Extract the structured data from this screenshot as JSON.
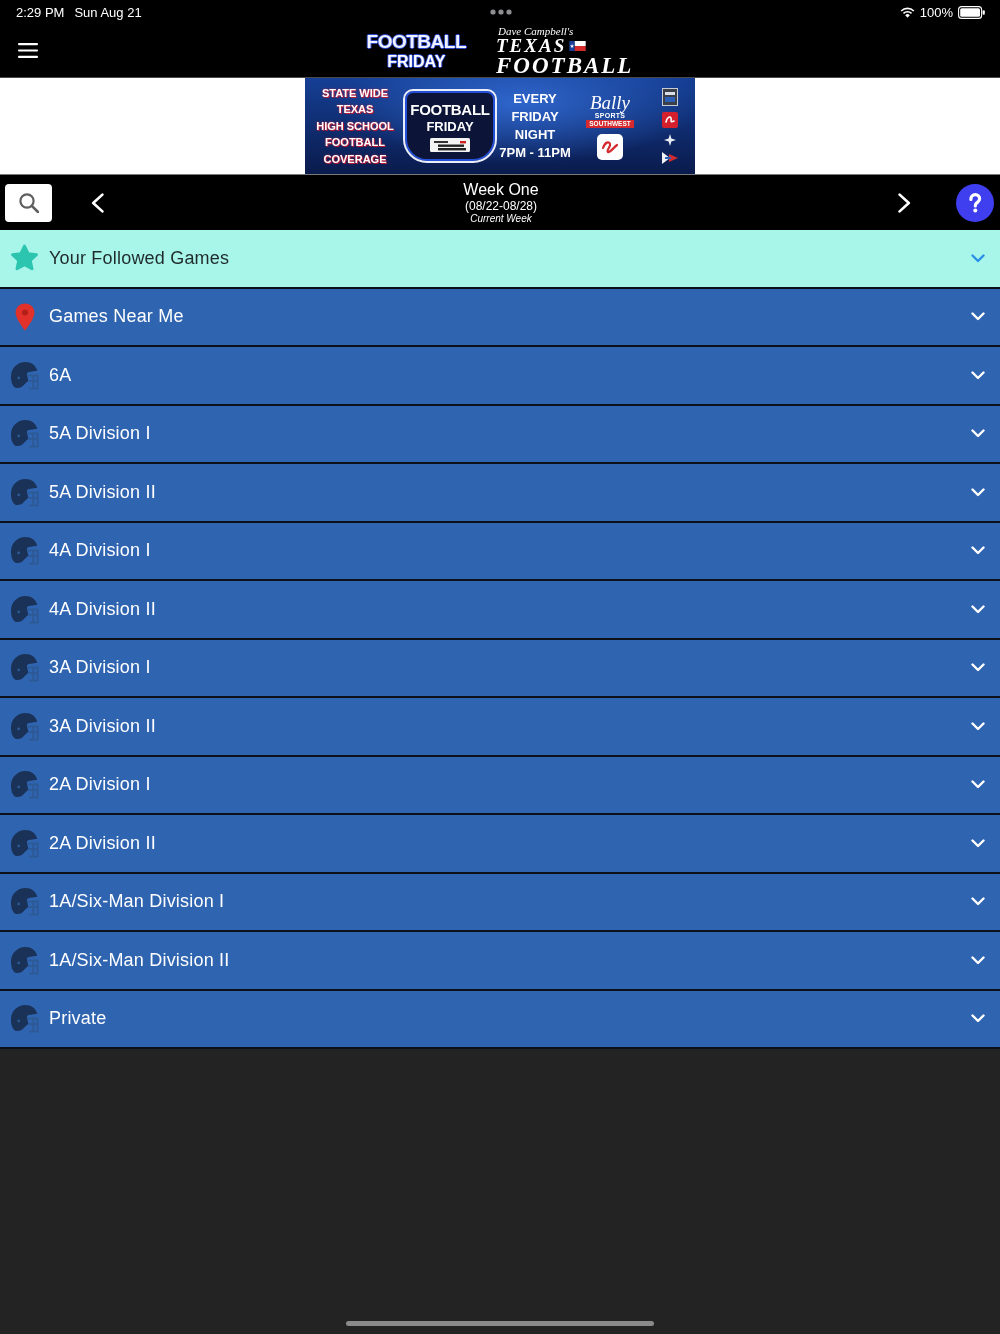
{
  "status_bar": {
    "time": "2:29 PM",
    "date": "Sun Aug 21",
    "battery": "100%"
  },
  "header": {
    "logo_left": {
      "line_1": "FOOTBALL",
      "line_2": "FRIDAY"
    },
    "logo_right": {
      "script": "Dave Campbell's",
      "line_1": "TEXAS",
      "line_2": "FOOTBALL"
    }
  },
  "banner": {
    "coverage_lines": [
      "STATE WIDE",
      "TEXAS",
      "HIGH SCHOOL",
      "FOOTBALL",
      "COVERAGE"
    ],
    "logo": {
      "line_1": "FOOTBALL",
      "line_2": "FRIDAY"
    },
    "schedule_lines": [
      "EVERY",
      "FRIDAY",
      "NIGHT",
      "7PM - 11PM"
    ],
    "network": {
      "script": "Bally",
      "line_1": "SPORTS",
      "line_2": "SOUTHWEST"
    }
  },
  "week_nav": {
    "title": "Week One",
    "dates": "(08/22-08/28)",
    "subtitle": "Current Week"
  },
  "sections": [
    {
      "kind": "followed",
      "label": "Your Followed Games",
      "expanded": false
    },
    {
      "kind": "nearby",
      "label": "Games Near Me",
      "expanded": false
    },
    {
      "kind": "division",
      "label": "6A",
      "expanded": false
    },
    {
      "kind": "division",
      "label": "5A Division I",
      "expanded": false
    },
    {
      "kind": "division",
      "label": "5A Division II",
      "expanded": false
    },
    {
      "kind": "division",
      "label": "4A Division I",
      "expanded": false
    },
    {
      "kind": "division",
      "label": "4A Division II",
      "expanded": false
    },
    {
      "kind": "division",
      "label": "3A Division I",
      "expanded": false
    },
    {
      "kind": "division",
      "label": "3A Division II",
      "expanded": false
    },
    {
      "kind": "division",
      "label": "2A Division I",
      "expanded": false
    },
    {
      "kind": "division",
      "label": "2A Division II",
      "expanded": false
    },
    {
      "kind": "division",
      "label": "1A/Six-Man Division I",
      "expanded": false
    },
    {
      "kind": "division",
      "label": "1A/Six-Man Division II",
      "expanded": false
    },
    {
      "kind": "division",
      "label": "Private",
      "expanded": false
    }
  ]
}
